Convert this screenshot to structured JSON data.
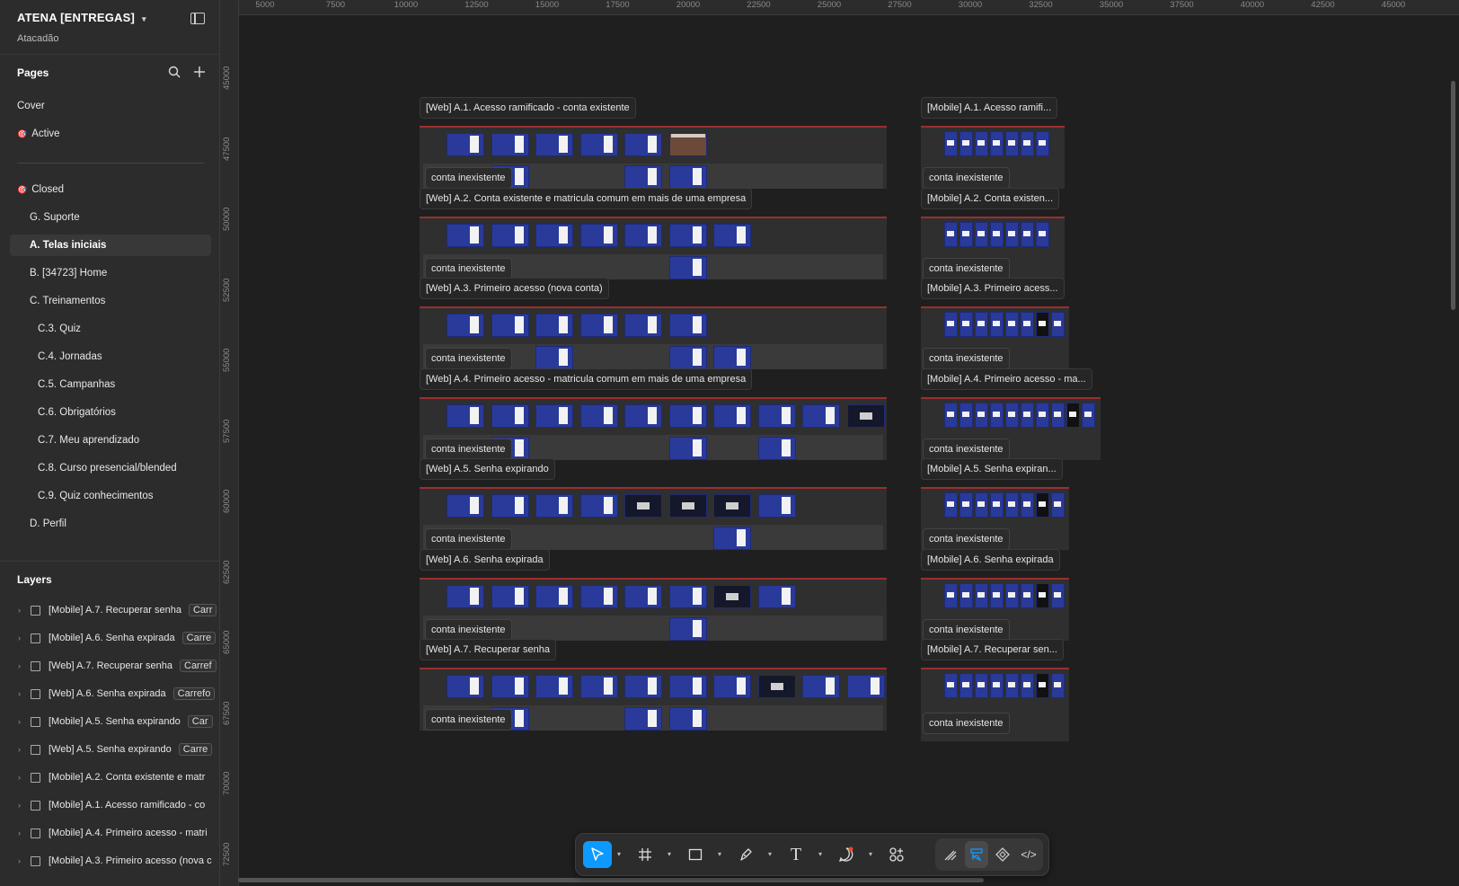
{
  "file": {
    "name": "ATENA [ENTREGAS]",
    "team": "Atacadão"
  },
  "pages": {
    "title": "Pages",
    "items": [
      {
        "label": "Cover",
        "icon": ""
      },
      {
        "label": "Active",
        "icon": "🎯"
      },
      {
        "label": "Closed",
        "icon": "🎯"
      },
      {
        "label": "G. Suporte",
        "icon": ""
      },
      {
        "label": "A. Telas iniciais",
        "icon": ""
      },
      {
        "label": "B. [34723] Home",
        "icon": ""
      },
      {
        "label": "C. Treinamentos",
        "icon": ""
      },
      {
        "label": "C.3. Quiz",
        "icon": ""
      },
      {
        "label": "C.4. Jornadas",
        "icon": ""
      },
      {
        "label": "C.5. Campanhas",
        "icon": ""
      },
      {
        "label": "C.6. Obrigatórios",
        "icon": ""
      },
      {
        "label": "C.7. Meu aprendizado",
        "icon": ""
      },
      {
        "label": "C.8. Curso presencial/blended",
        "icon": ""
      },
      {
        "label": "C.9. Quiz conhecimentos",
        "icon": ""
      },
      {
        "label": "D. Perfil",
        "icon": ""
      }
    ],
    "selected": "A. Telas iniciais"
  },
  "layers": {
    "title": "Layers",
    "items": [
      {
        "name": "[Mobile] A.7. Recuperar senha",
        "tag": "Carr"
      },
      {
        "name": "[Mobile] A.6. Senha expirada",
        "tag": "Carre"
      },
      {
        "name": "[Web] A.7. Recuperar senha",
        "tag": "Carref"
      },
      {
        "name": "[Web] A.6. Senha expirada",
        "tag": "Carrefo"
      },
      {
        "name": "[Mobile] A.5. Senha expirando",
        "tag": "Car"
      },
      {
        "name": "[Web] A.5. Senha expirando",
        "tag": "Carre"
      },
      {
        "name": "[Mobile] A.2. Conta existente e matr",
        "tag": ""
      },
      {
        "name": "[Mobile] A.1. Acesso ramificado - co",
        "tag": ""
      },
      {
        "name": "[Mobile] A.4. Primeiro acesso - matri",
        "tag": ""
      },
      {
        "name": "[Mobile] A.3. Primeiro acesso (nova c",
        "tag": ""
      }
    ]
  },
  "rulers": {
    "top": [
      "5000",
      "7500",
      "10000",
      "12500",
      "15000",
      "17500",
      "20000",
      "22500",
      "25000",
      "27500",
      "30000",
      "32500",
      "35000",
      "37500",
      "40000",
      "42500",
      "45000"
    ],
    "left": [
      "45000",
      "47500",
      "50000",
      "52500",
      "55000",
      "57500",
      "60000",
      "62500",
      "65000",
      "67500",
      "70000",
      "72500"
    ]
  },
  "canvas": {
    "web_frames": [
      {
        "title": "[Web] A.1. Acesso ramificado - conta existente",
        "badge": "conta inexistente"
      },
      {
        "title": "[Web] A.2. Conta existente e matricula comum em mais de uma empresa",
        "badge": "conta inexistente"
      },
      {
        "title": "[Web] A.3. Primeiro acesso (nova conta)",
        "badge": "conta inexistente"
      },
      {
        "title": "[Web] A.4. Primeiro acesso - matricula comum em mais de uma empresa",
        "badge": "conta inexistente"
      },
      {
        "title": "[Web] A.5. Senha expirando",
        "badge": "conta inexistente"
      },
      {
        "title": "[Web] A.6. Senha expirada",
        "badge": "conta inexistente"
      },
      {
        "title": "[Web] A.7. Recuperar senha",
        "badge": "conta inexistente"
      }
    ],
    "mobile_frames": [
      {
        "title": "[Mobile] A.1. Acesso ramifi...",
        "badge": "conta inexistente"
      },
      {
        "title": "[Mobile] A.2. Conta existen...",
        "badge": "conta inexistente"
      },
      {
        "title": "[Mobile] A.3. Primeiro acess...",
        "badge": "conta inexistente"
      },
      {
        "title": "[Mobile] A.4. Primeiro acesso - ma...",
        "badge": "conta inexistente"
      },
      {
        "title": "[Mobile] A.5. Senha expiran...",
        "badge": "conta inexistente"
      },
      {
        "title": "[Mobile] A.6. Senha expirada",
        "badge": "conta inexistente"
      },
      {
        "title": "[Mobile] A.7. Recuperar sen...",
        "badge": "conta inexistente"
      }
    ]
  },
  "toolbar": {
    "tools": [
      "move-tool",
      "frame-tool",
      "shape-tool",
      "pen-tool",
      "text-tool",
      "comment-tool",
      "actions-tool"
    ],
    "modes": [
      "draw-mode",
      "design-mode",
      "dev-mode",
      "code-mode"
    ],
    "active_tool": "move-tool",
    "accent_color": "#0d99ff"
  }
}
